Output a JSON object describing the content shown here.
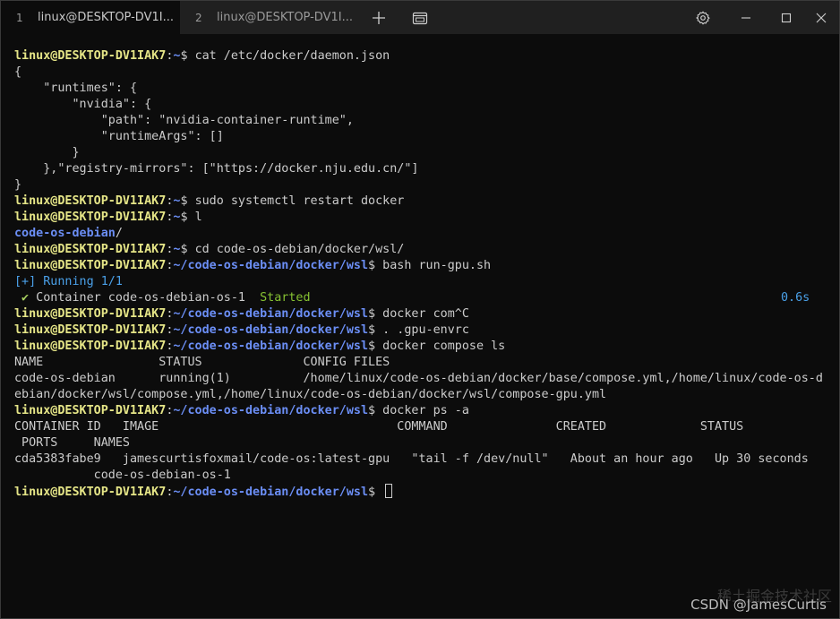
{
  "tabs": [
    {
      "num": "1",
      "title": "linux@DESKTOP-DV1I..."
    },
    {
      "num": "2",
      "title": "linux@DESKTOP-DV1I..."
    }
  ],
  "titlebar_icons": [
    "new-tab-icon",
    "tab-switcher-icon",
    "gear-icon",
    "minimize-icon",
    "maximize-icon",
    "close-icon"
  ],
  "prompt": {
    "user_host": "linux@DESKTOP-DV1IAK7",
    "colon": ":",
    "dollar": "$ "
  },
  "lines": [
    {
      "kind": "prompt",
      "path": "~",
      "cmd": "cat /etc/docker/daemon.json"
    },
    {
      "kind": "text",
      "text": "{"
    },
    {
      "kind": "text",
      "text": "    \"runtimes\": {"
    },
    {
      "kind": "text",
      "text": "        \"nvidia\": {"
    },
    {
      "kind": "text",
      "text": "            \"path\": \"nvidia-container-runtime\","
    },
    {
      "kind": "text",
      "text": "            \"runtimeArgs\": []"
    },
    {
      "kind": "text",
      "text": "        }"
    },
    {
      "kind": "text",
      "text": "    },\"registry-mirrors\": [\"https://docker.nju.edu.cn/\"]"
    },
    {
      "kind": "text",
      "text": "}"
    },
    {
      "kind": "prompt",
      "path": "~",
      "cmd": "sudo systemctl restart docker"
    },
    {
      "kind": "prompt",
      "path": "~",
      "cmd": "l"
    },
    {
      "kind": "dir",
      "text": "code-os-debian",
      "suffix": "/"
    },
    {
      "kind": "prompt",
      "path": "~",
      "cmd": "cd code-os-debian/docker/wsl/"
    },
    {
      "kind": "prompt",
      "path": "~/code-os-debian/docker/wsl",
      "cmd": "bash run-gpu.sh"
    },
    {
      "kind": "running",
      "text": "[+] Running 1/1"
    },
    {
      "kind": "started",
      "check": " ✔",
      "name": " Container code-os-debian-os-1  ",
      "status": "Started",
      "time": "0.6s"
    },
    {
      "kind": "prompt",
      "path": "~/code-os-debian/docker/wsl",
      "cmd": "docker com^C"
    },
    {
      "kind": "prompt",
      "path": "~/code-os-debian/docker/wsl",
      "cmd": ". .gpu-envrc"
    },
    {
      "kind": "prompt",
      "path": "~/code-os-debian/docker/wsl",
      "cmd": "docker compose ls"
    },
    {
      "kind": "text",
      "text": "NAME                STATUS              CONFIG FILES"
    },
    {
      "kind": "text",
      "text": "code-os-debian      running(1)          /home/linux/code-os-debian/docker/base/compose.yml,/home/linux/code-os-d"
    },
    {
      "kind": "text",
      "text": "ebian/docker/wsl/compose.yml,/home/linux/code-os-debian/docker/wsl/compose-gpu.yml"
    },
    {
      "kind": "prompt",
      "path": "~/code-os-debian/docker/wsl",
      "cmd": "docker ps -a"
    },
    {
      "kind": "text",
      "text": "CONTAINER ID   IMAGE                                 COMMAND               CREATED             STATUS"
    },
    {
      "kind": "text",
      "text": " PORTS     NAMES"
    },
    {
      "kind": "text",
      "text": "cda5383fabe9   jamescurtisfoxmail/code-os:latest-gpu   \"tail -f /dev/null\"   About an hour ago   Up 30 seconds"
    },
    {
      "kind": "text",
      "text": "           code-os-debian-os-1"
    },
    {
      "kind": "prompt_cursor",
      "path": "~/code-os-debian/docker/wsl",
      "cmd": ""
    }
  ],
  "watermark": "CSDN @JamesCurtis",
  "watermark_faint": "稀土掘金技术社区",
  "colors": {
    "user_host": "#e5e587",
    "path": "#6b8ef5",
    "running": "#4aa0e8",
    "started": "#86c232",
    "background": "#0c0c0c"
  }
}
